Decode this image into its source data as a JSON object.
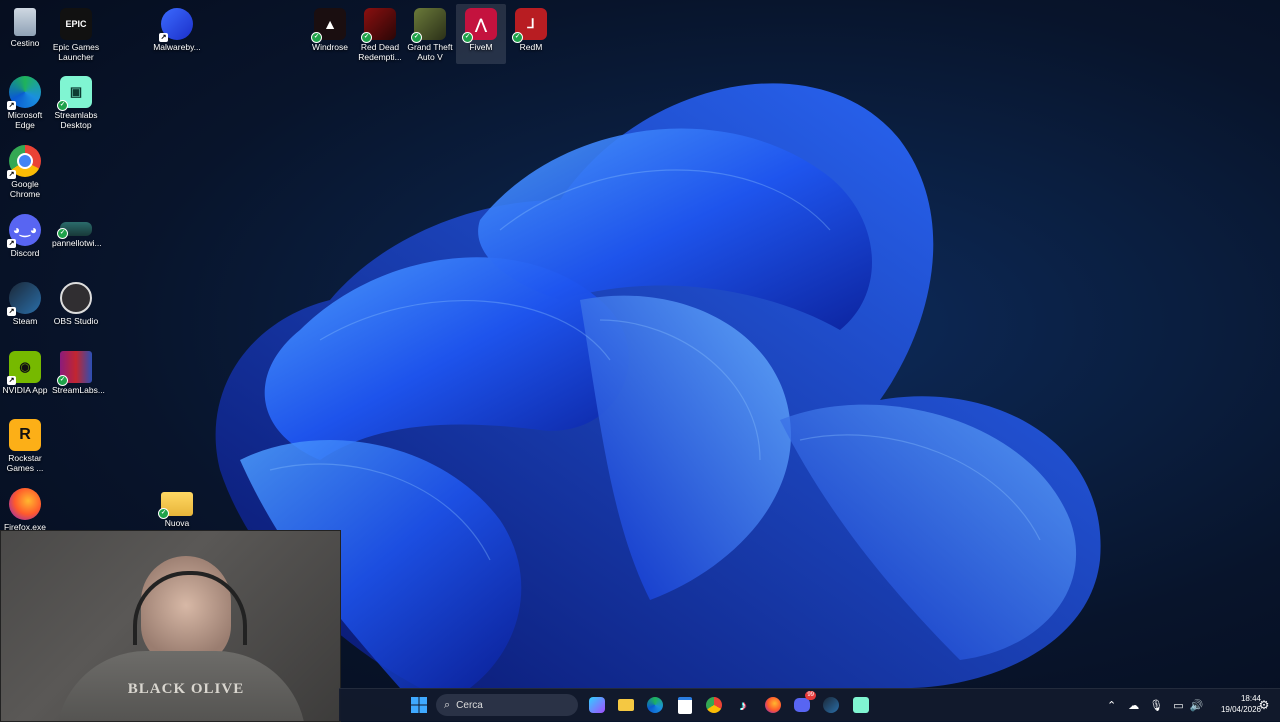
{
  "desktop_icons": [
    {
      "label": "Cestino"
    },
    {
      "label": "Epic Games Launcher"
    },
    {
      "label": "Malwareby..."
    },
    {
      "label": "Windrose"
    },
    {
      "label": "Red Dead Redempti..."
    },
    {
      "label": "Grand Theft Auto V"
    },
    {
      "label": "FiveM"
    },
    {
      "label": "RedM"
    },
    {
      "label": "Microsoft Edge"
    },
    {
      "label": "Streamlabs Desktop"
    },
    {
      "label": "Google Chrome"
    },
    {
      "label": "Discord"
    },
    {
      "label": "pannellotwi..."
    },
    {
      "label": "Steam"
    },
    {
      "label": "OBS Studio"
    },
    {
      "label": "NVIDIA App"
    },
    {
      "label": "StreamLabs..."
    },
    {
      "label": "Rockstar Games ..."
    },
    {
      "label": "Firefox.exe"
    },
    {
      "label": "Nuova"
    }
  ],
  "icon_glyphs": {
    "epic": "EPIC",
    "rockstar": "R"
  },
  "webcam": {
    "shirt_text": "BLACK OLIVE"
  },
  "taskbar": {
    "search_placeholder": "Cerca",
    "time": "18:44",
    "date": "19/04/2026",
    "discord_badge": "99"
  },
  "colors": {
    "accent": "#1a56ff",
    "taskbar": "#121a2d"
  }
}
